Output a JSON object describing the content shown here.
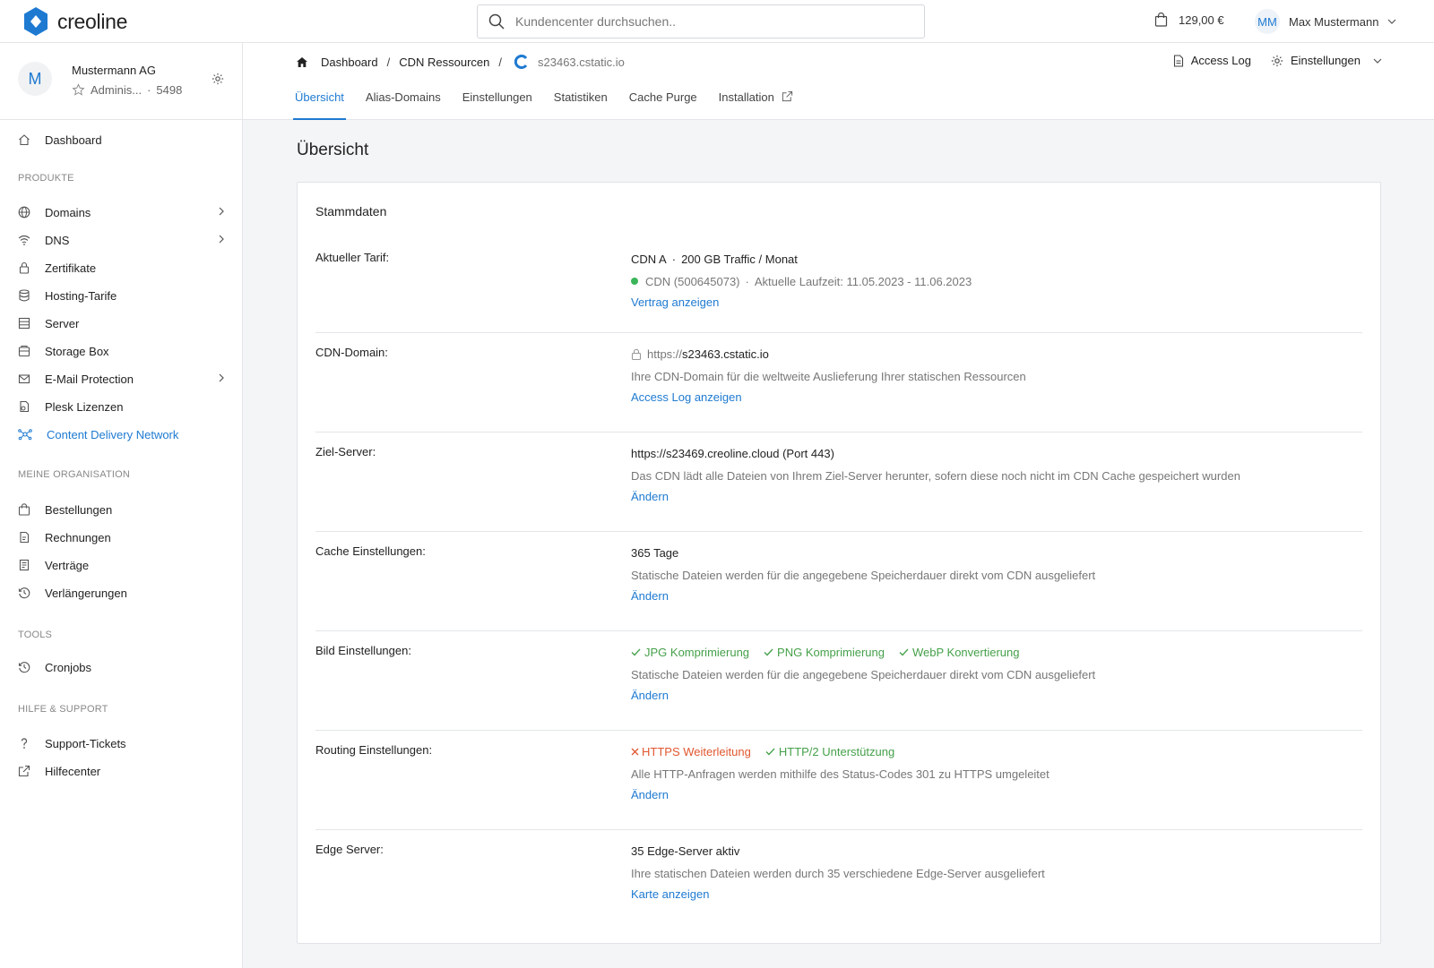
{
  "app": {
    "name": "creoline"
  },
  "search": {
    "placeholder": "Kundencenter durchsuchen.."
  },
  "cart": {
    "amount": "129,00 €"
  },
  "user": {
    "initials": "MM",
    "name": "Max Mustermann"
  },
  "organization": {
    "initial": "M",
    "name": "Mustermann AG",
    "role": "Adminis...",
    "number": "5498"
  },
  "sidebar": {
    "dashboard": "Dashboard",
    "sections": {
      "produkte": "PRODUKTE",
      "organisation": "MEINE ORGANISATION",
      "tools": "TOOLS",
      "hilfe": "HILFE & SUPPORT"
    },
    "produkte": [
      "Domains",
      "DNS",
      "Zertifikate",
      "Hosting-Tarife",
      "Server",
      "Storage Box",
      "E-Mail Protection",
      "Plesk Lizenzen",
      "Content Delivery Network"
    ],
    "organisation": [
      "Bestellungen",
      "Rechnungen",
      "Verträge",
      "Verlängerungen"
    ],
    "tools": [
      "Cronjobs"
    ],
    "hilfe": [
      "Support-Tickets",
      "Hilfecenter"
    ]
  },
  "breadcrumb": {
    "home": "Dashboard",
    "parent": "CDN Ressourcen",
    "current": "s23463.cstatic.io"
  },
  "header_actions": {
    "access_log": "Access Log",
    "settings": "Einstellungen"
  },
  "tabs": [
    "Übersicht",
    "Alias-Domains",
    "Einstellungen",
    "Statistiken",
    "Cache Purge",
    "Installation"
  ],
  "page": {
    "title": "Übersicht"
  },
  "card": {
    "title": "Stammdaten",
    "tarif": {
      "label": "Aktueller Tarif:",
      "plan": "CDN A",
      "traffic": "200 GB Traffic / Monat",
      "contract": "CDN (500645073)",
      "runtime": "Aktuelle Laufzeit: 11.05.2023 - 11.06.2023",
      "link": "Vertrag anzeigen"
    },
    "domain": {
      "label": "CDN-Domain:",
      "prefix": "https://",
      "host": "s23463.cstatic.io",
      "desc": "Ihre CDN-Domain für die weltweite Auslieferung Ihrer statischen Ressourcen",
      "link": "Access Log anzeigen"
    },
    "target": {
      "label": "Ziel-Server:",
      "value": "https://s23469.creoline.cloud (Port 443)",
      "desc": "Das CDN lädt alle Dateien von Ihrem Ziel-Server herunter, sofern diese noch nicht im CDN Cache gespeichert wurden",
      "link": "Ändern"
    },
    "cache": {
      "label": "Cache Einstellungen:",
      "value": "365 Tage",
      "desc": "Statische Dateien werden für die angegebene Speicherdauer direkt vom CDN ausgeliefert",
      "link": "Ändern"
    },
    "image": {
      "label": "Bild Einstellungen:",
      "jpg": "JPG Komprimierung",
      "png": "PNG Komprimierung",
      "webp": "WebP Konvertierung",
      "desc": "Statische Dateien werden für die angegebene Speicherdauer direkt vom CDN ausgeliefert",
      "link": "Ändern"
    },
    "routing": {
      "label": "Routing Einstellungen:",
      "https": "HTTPS Weiterleitung",
      "http2": "HTTP/2 Unterstützung",
      "desc": "Alle HTTP-Anfragen werden mithilfe des Status-Codes 301 zu HTTPS umgeleitet",
      "link": "Ändern"
    },
    "edge": {
      "label": "Edge Server:",
      "value": "35 Edge-Server aktiv",
      "desc": "Ihre statischen Dateien werden durch 35 verschiedene Edge-Server ausgeliefert",
      "link": "Karte anzeigen"
    }
  },
  "colors": {
    "accent": "#1e7ad1",
    "ok": "#45a04a",
    "error": "#e0572f",
    "status_active": "#3bb55a"
  }
}
